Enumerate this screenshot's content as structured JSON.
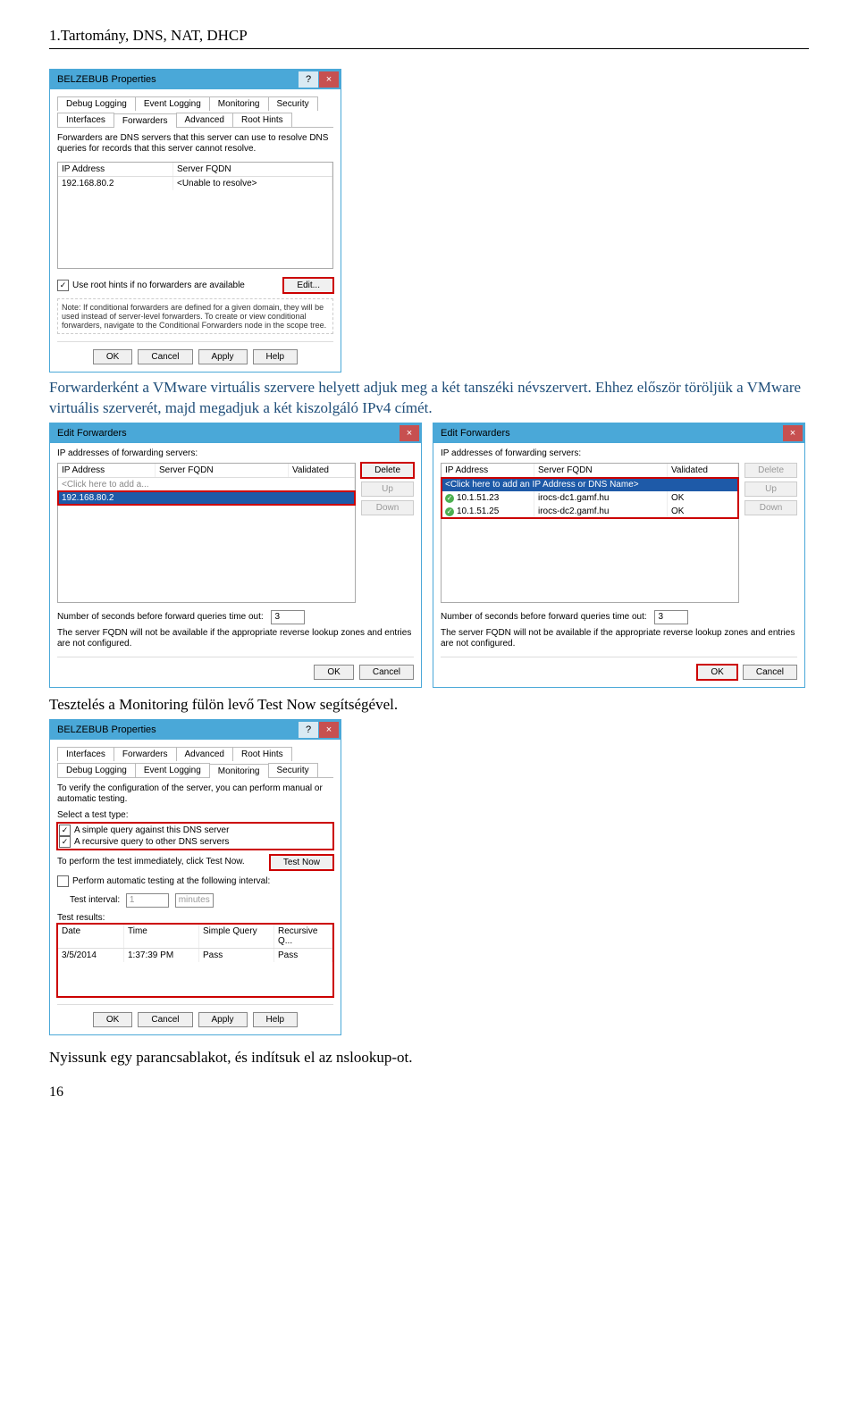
{
  "header": "1.Tartomány, DNS, NAT, DHCP",
  "para1": "Forwarderként a VMware virtuális szervere helyett adjuk meg a két tanszéki névszervert. Ehhez először töröljük a VMware virtuális szerverét, majd megadjuk a két kiszolgáló IPv4 címét.",
  "para2": "Tesztelés a Monitoring fülön levő Test Now segítségével.",
  "para3": "Nyissunk egy parancsablakot, és indítsuk el az nslookup-ot.",
  "page_number": "16",
  "props": {
    "title": "BELZEBUB Properties",
    "help": "?",
    "close": "×",
    "tabs_row1": [
      "Debug Logging",
      "Event Logging",
      "Monitoring",
      "Security"
    ],
    "tabs_row2": [
      "Interfaces",
      "Forwarders",
      "Advanced",
      "Root Hints"
    ],
    "intro": "Forwarders are DNS servers that this server can use to resolve DNS queries for records that this server cannot resolve.",
    "col_ip": "IP Address",
    "col_fqdn": "Server FQDN",
    "row_ip": "192.168.80.2",
    "row_fqdn": "<Unable to resolve>",
    "use_root": "Use root hints if no forwarders are available",
    "edit": "Edit...",
    "note": "Note: If conditional forwarders are defined for a given domain, they will be used instead of server-level forwarders. To create or view conditional forwarders, navigate to the Conditional Forwarders node in the scope tree.",
    "ok": "OK",
    "cancel": "Cancel",
    "apply": "Apply",
    "help_btn": "Help"
  },
  "editfwd": {
    "title": "Edit Forwarders",
    "close": "×",
    "ip_label": "IP addresses of forwarding servers:",
    "col_ip": "IP Address",
    "col_fqdn": "Server FQDN",
    "col_valid": "Validated",
    "click_add": "<Click here to add a...",
    "click_add2": "<Click here to add an IP Address or DNS Name>",
    "sel_ip": "192.168.80.2",
    "delete": "Delete",
    "up": "Up",
    "down": "Down",
    "timeout_label": "Number of seconds before forward queries time out:",
    "timeout_val": "3",
    "note": "The server FQDN will not be available if the appropriate reverse lookup zones and entries are not configured.",
    "ok": "OK",
    "cancel": "Cancel",
    "rows": [
      {
        "ip": "10.1.51.23",
        "fqdn": "irocs-dc1.gamf.hu",
        "valid": "OK"
      },
      {
        "ip": "10.1.51.25",
        "fqdn": "irocs-dc2.gamf.hu",
        "valid": "OK"
      }
    ]
  },
  "monitor": {
    "title": "BELZEBUB Properties",
    "help": "?",
    "close": "×",
    "tabs_row1": [
      "Interfaces",
      "Forwarders",
      "Advanced",
      "Root Hints"
    ],
    "tabs_row2": [
      "Debug Logging",
      "Event Logging",
      "Monitoring",
      "Security"
    ],
    "intro": "To verify the configuration of the server, you can perform manual or automatic testing.",
    "select_label": "Select a test type:",
    "simple": "A simple query against this DNS server",
    "recursive": "A recursive query to other DNS servers",
    "perform": "To perform the test immediately, click Test Now.",
    "test_now": "Test Now",
    "auto": "Perform automatic testing at the following interval:",
    "interval_label": "Test interval:",
    "interval_val": "1",
    "interval_unit": "minutes",
    "results_label": "Test results:",
    "cols": [
      "Date",
      "Time",
      "Simple Query",
      "Recursive Q..."
    ],
    "row": [
      "3/5/2014",
      "1:37:39 PM",
      "Pass",
      "Pass"
    ],
    "ok": "OK",
    "cancel": "Cancel",
    "apply": "Apply",
    "help_btn": "Help"
  }
}
